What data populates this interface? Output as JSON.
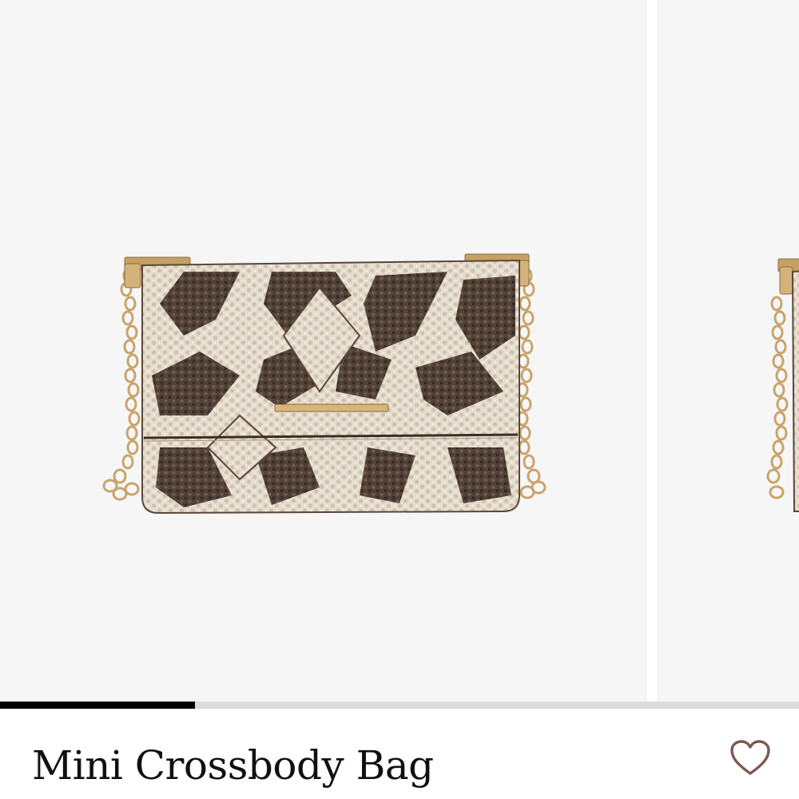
{
  "product": {
    "title": "Mini Crossbody Bag"
  },
  "carousel": {
    "image_alt": "Snake print mini crossbody bag with gold chain strap",
    "progress_fraction": 0.244
  },
  "actions": {
    "favorite_icon": "heart-outline-icon"
  },
  "colors": {
    "favorite_icon": "#7a5a52",
    "progress_track": "#dcdcdc",
    "progress_fill": "#000000",
    "image_bg": "#f6f6f7"
  }
}
